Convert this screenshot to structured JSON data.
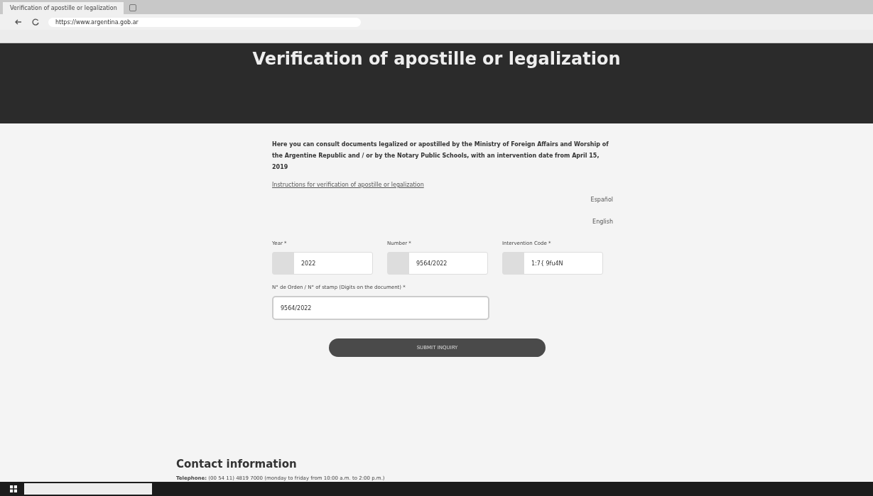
{
  "browser": {
    "tab_title": "Verification of apostille or legalization",
    "address": "https://www.argentina.gob.ar"
  },
  "banner": {
    "title": "Verification of apostille or legalization"
  },
  "intro": "Here you can consult documents legalized or apostilled by the Ministry of Foreign Affairs and Worship of the Argentine Republic and / or by the Notary Public Schools, with an intervention date from April 15, 2019",
  "instructions_link": "Instructions for verification of apostille or legalization",
  "languages": [
    {
      "label": "Español"
    },
    {
      "label": "English"
    }
  ],
  "fields": [
    {
      "label": "Year *",
      "value": "2022"
    },
    {
      "label": "Number *",
      "value": "9564/2022"
    },
    {
      "label": "Intervention Code *",
      "value": "1:7{ 9fu4N"
    }
  ],
  "order_field": {
    "label": "N° de Orden / N° of stamp (Digits on the document) *",
    "value": "9564/2022"
  },
  "submit": "SUBMIT INQUIRY",
  "contact": {
    "title": "Contact information",
    "telephone_label": "Telephone:",
    "telephone": "(00 54 11) 4819 7000 (monday to friday from 10:00 a.m. to 2:00 p.m.)"
  }
}
